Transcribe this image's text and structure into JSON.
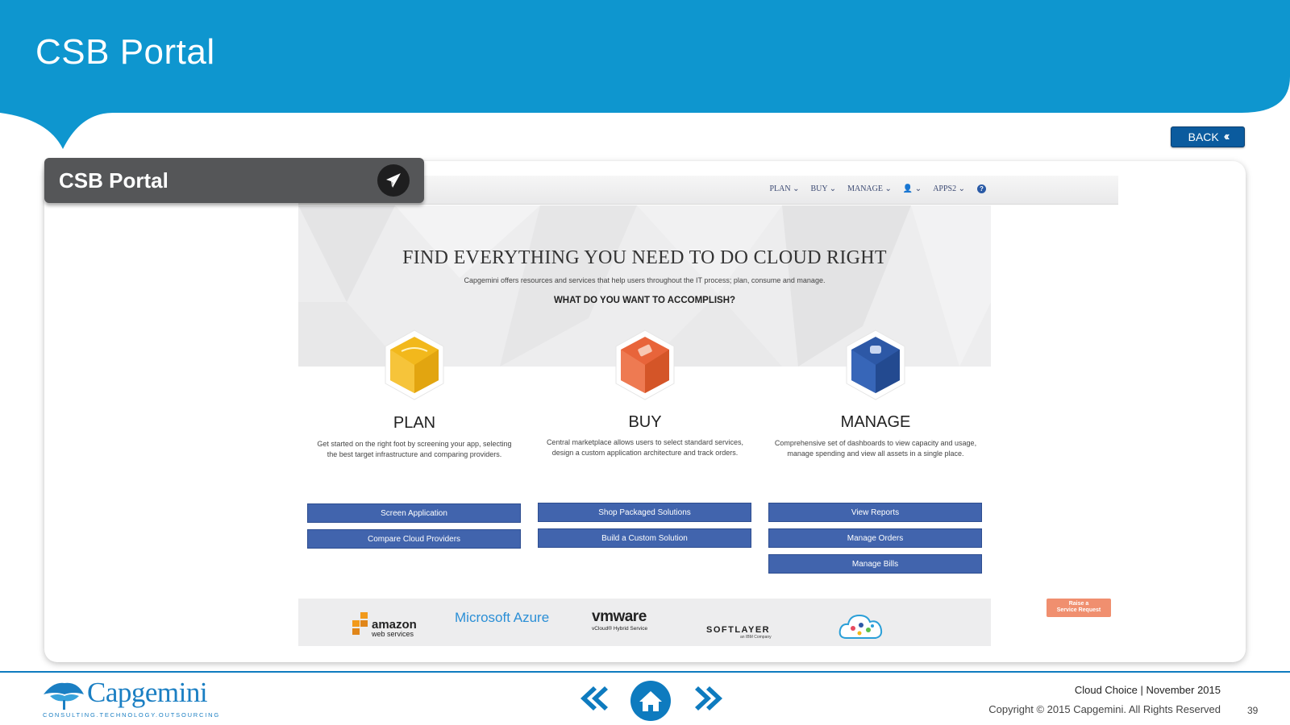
{
  "slide": {
    "title": "CSB Portal",
    "back_label": "BACK",
    "card_label": "CSB Portal",
    "page_number": "39",
    "footer_line1": "Cloud Choice | November 2015",
    "footer_line2": "Copyright © 2015 Capgemini.  All Rights Reserved"
  },
  "logo": {
    "name": "Capgemini",
    "tagline": "CONSULTING.TECHNOLOGY.OUTSOURCING"
  },
  "portal": {
    "nav": [
      "PLAN ⌄",
      "BUY ⌄",
      "MANAGE ⌄",
      "👤 ⌄",
      "APPS2 ⌄"
    ],
    "hero_title": "FIND EVERYTHING YOU NEED TO DO CLOUD RIGHT",
    "hero_subtitle": "Capgemini offers resources and services that help users throughout the IT process; plan, consume and manage.",
    "hero_question": "WHAT DO YOU WANT TO ACCOMPLISH?",
    "columns": [
      {
        "title": "PLAN",
        "desc_line1": "Get started on the right foot by screening your app, selecting",
        "desc_line2": "the best target infrastructure and comparing providers.",
        "color": "#f2b81c",
        "buttons": [
          "Screen Application",
          "Compare Cloud Providers"
        ]
      },
      {
        "title": "BUY",
        "desc_line1": "Central marketplace allows users to select standard services,",
        "desc_line2": "design a custom application architecture and track orders.",
        "color": "#e8643a",
        "buttons": [
          "Shop Packaged Solutions",
          "Build a Custom Solution"
        ]
      },
      {
        "title": "MANAGE",
        "desc_line1": "Comprehensive set of dashboards to view capacity and usage,",
        "desc_line2": "manage spending and view all assets in a single place.",
        "color": "#2d58a6",
        "buttons": [
          "View Reports",
          "Manage Orders",
          "Manage Bills"
        ]
      }
    ],
    "partners": {
      "amazon_1": "amazon",
      "amazon_2": "web services",
      "azure": "Microsoft Azure",
      "vmware": "vmware",
      "vmware_sub": "vCloud® Hybrid Service",
      "softlayer": "SOFTLAYER",
      "softlayer_sub": "an IBM Company"
    },
    "raise_request": [
      "Raise a",
      "Service Request"
    ]
  },
  "colors": {
    "banner": "#0e96cf",
    "button_blue": "#4164ad",
    "footer_blue": "#0e7bbf"
  }
}
